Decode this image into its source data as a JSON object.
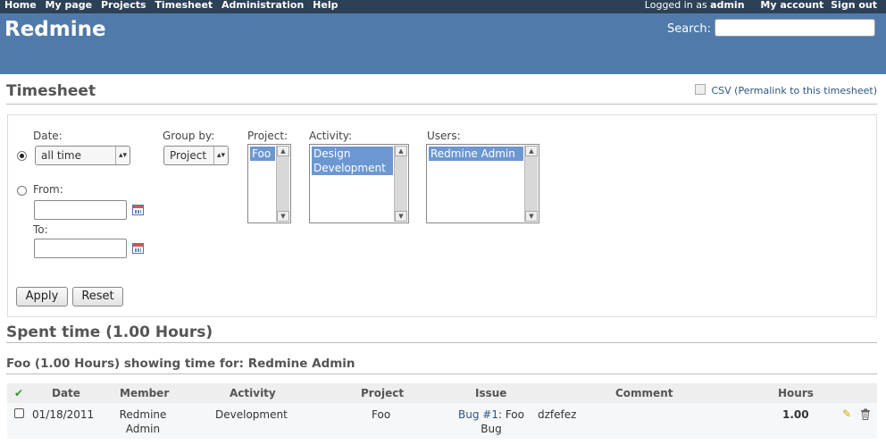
{
  "top_menu": {
    "items": [
      "Home",
      "My page",
      "Projects",
      "Timesheet",
      "Administration",
      "Help"
    ],
    "logged_prefix": "Logged in as",
    "logged_user": "admin",
    "my_account": "My account",
    "sign_out": "Sign out"
  },
  "header": {
    "title": "Redmine",
    "search_label": "Search:",
    "search_value": ""
  },
  "page": {
    "title": "Timesheet",
    "csv_label": "CSV",
    "permalink_label": "(Permalink to this timesheet)"
  },
  "filters": {
    "date_label": "Date:",
    "date_selected": "all time",
    "from_label": "From:",
    "to_label": "To:",
    "group_by_label": "Group by:",
    "group_by_selected": "Project",
    "project_label": "Project:",
    "project_options": [
      "Foo"
    ],
    "activity_label": "Activity:",
    "activity_options": [
      "Design",
      "Development"
    ],
    "users_label": "Users:",
    "users_options": [
      "Redmine Admin"
    ],
    "apply_label": "Apply",
    "reset_label": "Reset"
  },
  "summary": {
    "spent_time_heading": "Spent time (1.00 Hours)",
    "group_heading": "Foo (1.00 Hours) showing time for: Redmine Admin"
  },
  "table": {
    "headers": {
      "date": "Date",
      "member": "Member",
      "activity": "Activity",
      "project": "Project",
      "issue": "Issue",
      "comment": "Comment",
      "hours": "Hours"
    },
    "rows": [
      {
        "date": "01/18/2011",
        "member_line1": "Redmine",
        "member_line2": "Admin",
        "activity": "Development",
        "project": "Foo",
        "issue_link": "Bug #1",
        "issue_rest": ": Foo",
        "issue_line2": "Bug",
        "comment": "dzfefez",
        "hours": "1.00"
      }
    ]
  },
  "icons": {
    "check_all": "check-icon",
    "edit": "pencil-icon",
    "delete": "trash-icon",
    "calendar": "calendar-icon"
  }
}
